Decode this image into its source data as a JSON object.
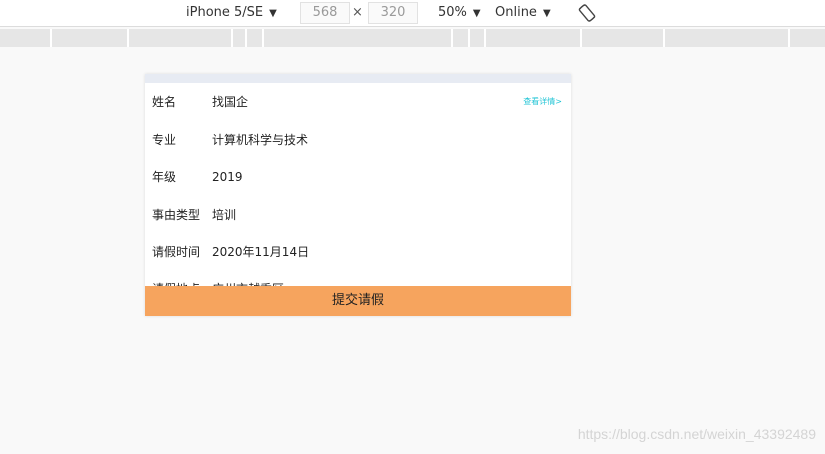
{
  "toolbar": {
    "device": "iPhone 5/SE",
    "width": "568",
    "height": "320",
    "times": "×",
    "zoom": "50%",
    "network": "Online",
    "dropdown_icon": "triangle-down-icon",
    "rotate_icon": "rotate-icon"
  },
  "form": {
    "detail_link": "查看详情>",
    "rows": [
      {
        "label": "姓名",
        "value": "找国企"
      },
      {
        "label": "专业",
        "value": "计算机科学与技术"
      },
      {
        "label": "年级",
        "value": "2019"
      },
      {
        "label": "事由类型",
        "value": "培训"
      },
      {
        "label": "请假时间",
        "value": "2020年11月14日"
      },
      {
        "label": "请假地点",
        "value": "广州市越秀区"
      }
    ],
    "submit_label": "提交请假"
  },
  "watermark": "https://blog.csdn.net/weixin_43392489",
  "colors": {
    "submit_bg": "#f6a45e",
    "link": "#23c5d6",
    "header_strip": "#e7ebf3"
  }
}
